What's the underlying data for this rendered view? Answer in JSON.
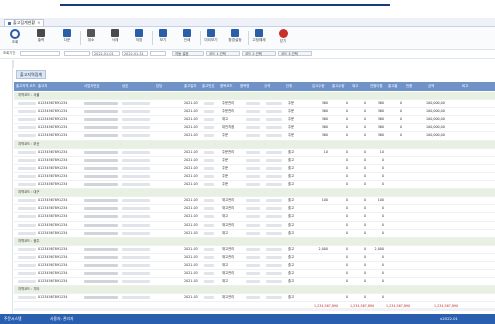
{
  "tab": {
    "label": "출고집계현황"
  },
  "toolbar": [
    {
      "label": "조회",
      "icon": "search-icon"
    },
    {
      "label": "출력",
      "icon": "print-icon"
    },
    {
      "label": "다운",
      "icon": "download-icon"
    },
    {
      "label": "취소",
      "icon": "undo-icon"
    },
    {
      "label": "삭제",
      "icon": "trash-icon"
    },
    {
      "label": "저장",
      "icon": "save-icon"
    },
    {
      "label": "보기",
      "icon": "eye-icon"
    },
    {
      "label": "인쇄",
      "icon": "printer-icon"
    },
    {
      "label": "미리보기",
      "icon": "preview-icon"
    },
    {
      "label": "환경설정",
      "icon": "settings-icon"
    },
    {
      "label": "고정해제",
      "icon": "gear-icon"
    },
    {
      "label": "닫기",
      "icon": "close-icon"
    }
  ],
  "filter": {
    "label_a": "조회기간",
    "date_from": "2022-01-01",
    "date_to": "2022-01-31",
    "btn_a": "자동 설정",
    "btn_b": "코드 1 선택",
    "btn_c": "코드 2 선택",
    "btn_d": "코드 3 선택"
  },
  "section_tab": "출고지역집계",
  "columns": [
    "출고지역 코드",
    "출고지",
    "사업자번호",
    "상호",
    "담당",
    "출고일자",
    "출고번호",
    "품목코드",
    "품목명",
    "규격",
    "단위",
    "입고수량",
    "출고수량",
    "재고",
    "전월이월",
    "출고율",
    "반품",
    "금액",
    "비고"
  ],
  "groups": [
    {
      "title": "지역코드 : 서울",
      "rows": [
        {
          "a": "01234567891234",
          "b": "2021-03",
          "c": "주문관리",
          "d": "주문",
          "q1": "360",
          "q2": "0",
          "q3": "0",
          "q4": "360",
          "q5": "0",
          "amt": "100,000,00"
        },
        {
          "a": "01234567891234",
          "b": "2021-03",
          "c": "주문관리",
          "d": "주문",
          "q1": "360",
          "q2": "0",
          "q3": "0",
          "q4": "360",
          "q5": "0",
          "amt": "100,000,00"
        },
        {
          "a": "01234567891234",
          "b": "2021-03",
          "c": "재고",
          "d": "주문",
          "q1": "360",
          "q2": "0",
          "q3": "0",
          "q4": "360",
          "q5": "0",
          "amt": "100,000,00"
        },
        {
          "a": "01234567891234",
          "b": "2021-03",
          "c": "대전지점",
          "d": "주문",
          "q1": "360",
          "q2": "0",
          "q3": "0",
          "q4": "360",
          "q5": "0",
          "amt": "100,000,00"
        },
        {
          "a": "01234567891234",
          "b": "2021-03",
          "c": "주문",
          "d": "주문",
          "q1": "360",
          "q2": "0",
          "q3": "0",
          "q4": "360",
          "q5": "0",
          "amt": "100,000,00"
        }
      ]
    },
    {
      "title": "지역코드 : 부산",
      "rows": [
        {
          "a": "01234567891234",
          "b": "2021-03",
          "c": "주문관리",
          "d": "출고",
          "q1": "10",
          "q2": "0",
          "q3": "0",
          "q4": "10",
          "q5": "",
          "amt": ""
        },
        {
          "a": "01234567891234",
          "b": "2021-03",
          "c": "주문",
          "d": "출고",
          "q1": "",
          "q2": "0",
          "q3": "0",
          "q4": "0",
          "q5": "",
          "amt": ""
        },
        {
          "a": "01234567891234",
          "b": "2021-03",
          "c": "주문",
          "d": "출고",
          "q1": "",
          "q2": "0",
          "q3": "0",
          "q4": "0",
          "q5": "",
          "amt": ""
        },
        {
          "a": "01234567891234",
          "b": "2021-03",
          "c": "주문",
          "d": "출고",
          "q1": "",
          "q2": "0",
          "q3": "0",
          "q4": "0",
          "q5": "",
          "amt": ""
        },
        {
          "a": "01234567891234",
          "b": "2021-03",
          "c": "주문",
          "d": "출고",
          "q1": "",
          "q2": "0",
          "q3": "0",
          "q4": "0",
          "q5": "",
          "amt": ""
        }
      ]
    },
    {
      "title": "지역코드 : 대구",
      "rows": [
        {
          "a": "01234567891234",
          "b": "2021-03",
          "c": "재고관리",
          "d": "출고",
          "q1": "100",
          "q2": "0",
          "q3": "0",
          "q4": "100",
          "q5": "",
          "amt": ""
        },
        {
          "a": "01234567891234",
          "b": "2021-03",
          "c": "재고관리",
          "d": "출고",
          "q1": "",
          "q2": "0",
          "q3": "0",
          "q4": "0",
          "q5": "",
          "amt": ""
        },
        {
          "a": "01234567891234",
          "b": "2021-03",
          "c": "재고",
          "d": "출고",
          "q1": "",
          "q2": "0",
          "q3": "0",
          "q4": "0",
          "q5": "",
          "amt": ""
        },
        {
          "a": "01234567891234",
          "b": "2021-03",
          "c": "재고관리",
          "d": "출고",
          "q1": "",
          "q2": "0",
          "q3": "0",
          "q4": "0",
          "q5": "",
          "amt": ""
        },
        {
          "a": "01234567891234",
          "b": "2021-03",
          "c": "재고",
          "d": "출고",
          "q1": "",
          "q2": "0",
          "q3": "0",
          "q4": "0",
          "q5": "",
          "amt": ""
        }
      ]
    },
    {
      "title": "지역코드 : 광주",
      "rows": [
        {
          "a": "01234567891234",
          "b": "2021-03",
          "c": "재고관리",
          "d": "출고",
          "q1": "2,000",
          "q2": "0",
          "q3": "0",
          "q4": "2,000",
          "q5": "",
          "amt": ""
        },
        {
          "a": "01234567891234",
          "b": "2021-03",
          "c": "재고관리",
          "d": "출고",
          "q1": "",
          "q2": "0",
          "q3": "0",
          "q4": "0",
          "q5": "",
          "amt": ""
        },
        {
          "a": "01234567891234",
          "b": "2021-03",
          "c": "재고",
          "d": "출고",
          "q1": "",
          "q2": "0",
          "q3": "0",
          "q4": "0",
          "q5": "",
          "amt": ""
        },
        {
          "a": "01234567891234",
          "b": "2021-03",
          "c": "재고관리",
          "d": "출고",
          "q1": "",
          "q2": "0",
          "q3": "0",
          "q4": "0",
          "q5": "",
          "amt": ""
        },
        {
          "a": "01234567891234",
          "b": "2021-03",
          "c": "재고",
          "d": "출고",
          "q1": "",
          "q2": "0",
          "q3": "0",
          "q4": "0",
          "q5": "",
          "amt": ""
        }
      ]
    },
    {
      "title": "지역코드 : 기타",
      "rows": [
        {
          "a": "01234567891234",
          "b": "2021-03",
          "c": "재고관리",
          "d": "출고",
          "q1": "",
          "q2": "0",
          "q3": "0",
          "q4": "0",
          "q5": "",
          "amt": ""
        }
      ]
    }
  ],
  "totals": {
    "t1": "1,234,567,890",
    "t2": "1,234,567,890",
    "t3": "1,234,567,890",
    "t4": "1,234,567,890"
  },
  "status": {
    "s1": "주문시스템",
    "s2": "사용자: 관리자",
    "s3": "v2022.01"
  }
}
